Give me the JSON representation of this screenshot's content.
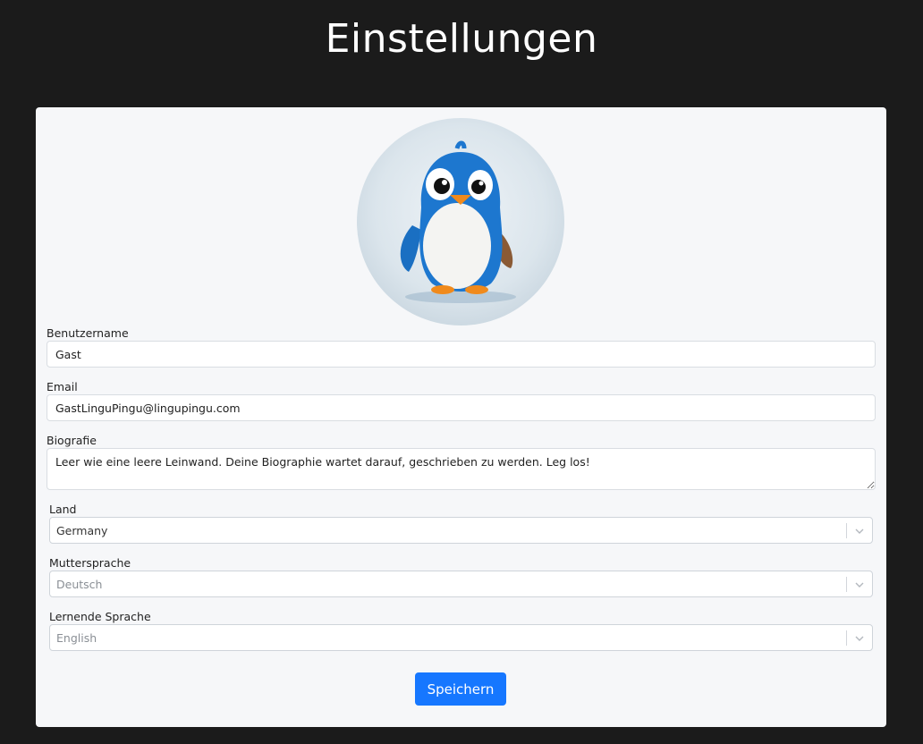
{
  "page": {
    "title": "Einstellungen"
  },
  "profile": {
    "avatar_icon": "penguin-avatar-icon"
  },
  "form": {
    "username": {
      "label": "Benutzername",
      "value": "Gast"
    },
    "email": {
      "label": "Email",
      "value": "GastLinguPingu@lingupingu.com"
    },
    "bio": {
      "label": "Biografie",
      "value": "Leer wie eine leere Leinwand. Deine Biographie wartet darauf, geschrieben zu werden. Leg los!"
    },
    "country": {
      "label": "Land",
      "value": "Germany"
    },
    "native_language": {
      "label": "Muttersprache",
      "value": "Deutsch"
    },
    "learning_language": {
      "label": "Lernende Sprache",
      "value": "English"
    },
    "save_label": "Speichern"
  },
  "colors": {
    "background": "#1b1b1b",
    "card": "#f6f7f9",
    "accent": "#1677ff"
  }
}
